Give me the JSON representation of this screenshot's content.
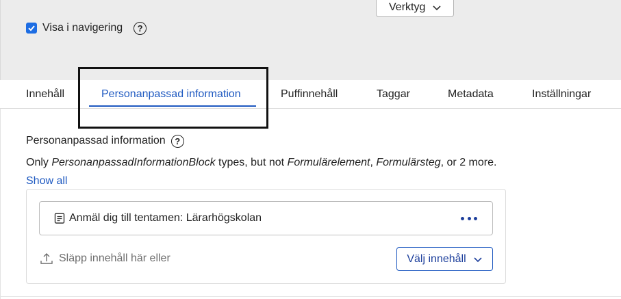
{
  "header": {
    "tools_button_label": "Verktyg",
    "show_in_navigation": {
      "label": "Visa i navigering",
      "checked": true
    }
  },
  "tabs": [
    {
      "label": "Innehåll",
      "active": false
    },
    {
      "label": "Personanpassad information",
      "active": true
    },
    {
      "label": "Puffinnehåll",
      "active": false
    },
    {
      "label": "Taggar",
      "active": false
    },
    {
      "label": "Metadata",
      "active": false
    },
    {
      "label": "Inställningar",
      "active": false
    }
  ],
  "section": {
    "title": "Personanpassad information",
    "help_glyph": "?",
    "description": {
      "prefix": "Only ",
      "allowed_type": "PersonanpassadInformationBlock",
      "middle": " types, but not ",
      "excluded_1": "Formulärelement",
      "sep": ", ",
      "excluded_2": "Formulärsteg",
      "suffix": ", or 2 more. ",
      "show_all": "Show all"
    }
  },
  "content_area": {
    "items": [
      {
        "label": "Anmäl dig till tentamen: Lärarhögskolan"
      }
    ],
    "drop_text": "Släpp innehåll här eller",
    "choose_button_label": "Välj innehåll"
  },
  "colors": {
    "accent": "#1d58c0",
    "checkbox": "#1d6de3",
    "top_background": "#ececec"
  }
}
